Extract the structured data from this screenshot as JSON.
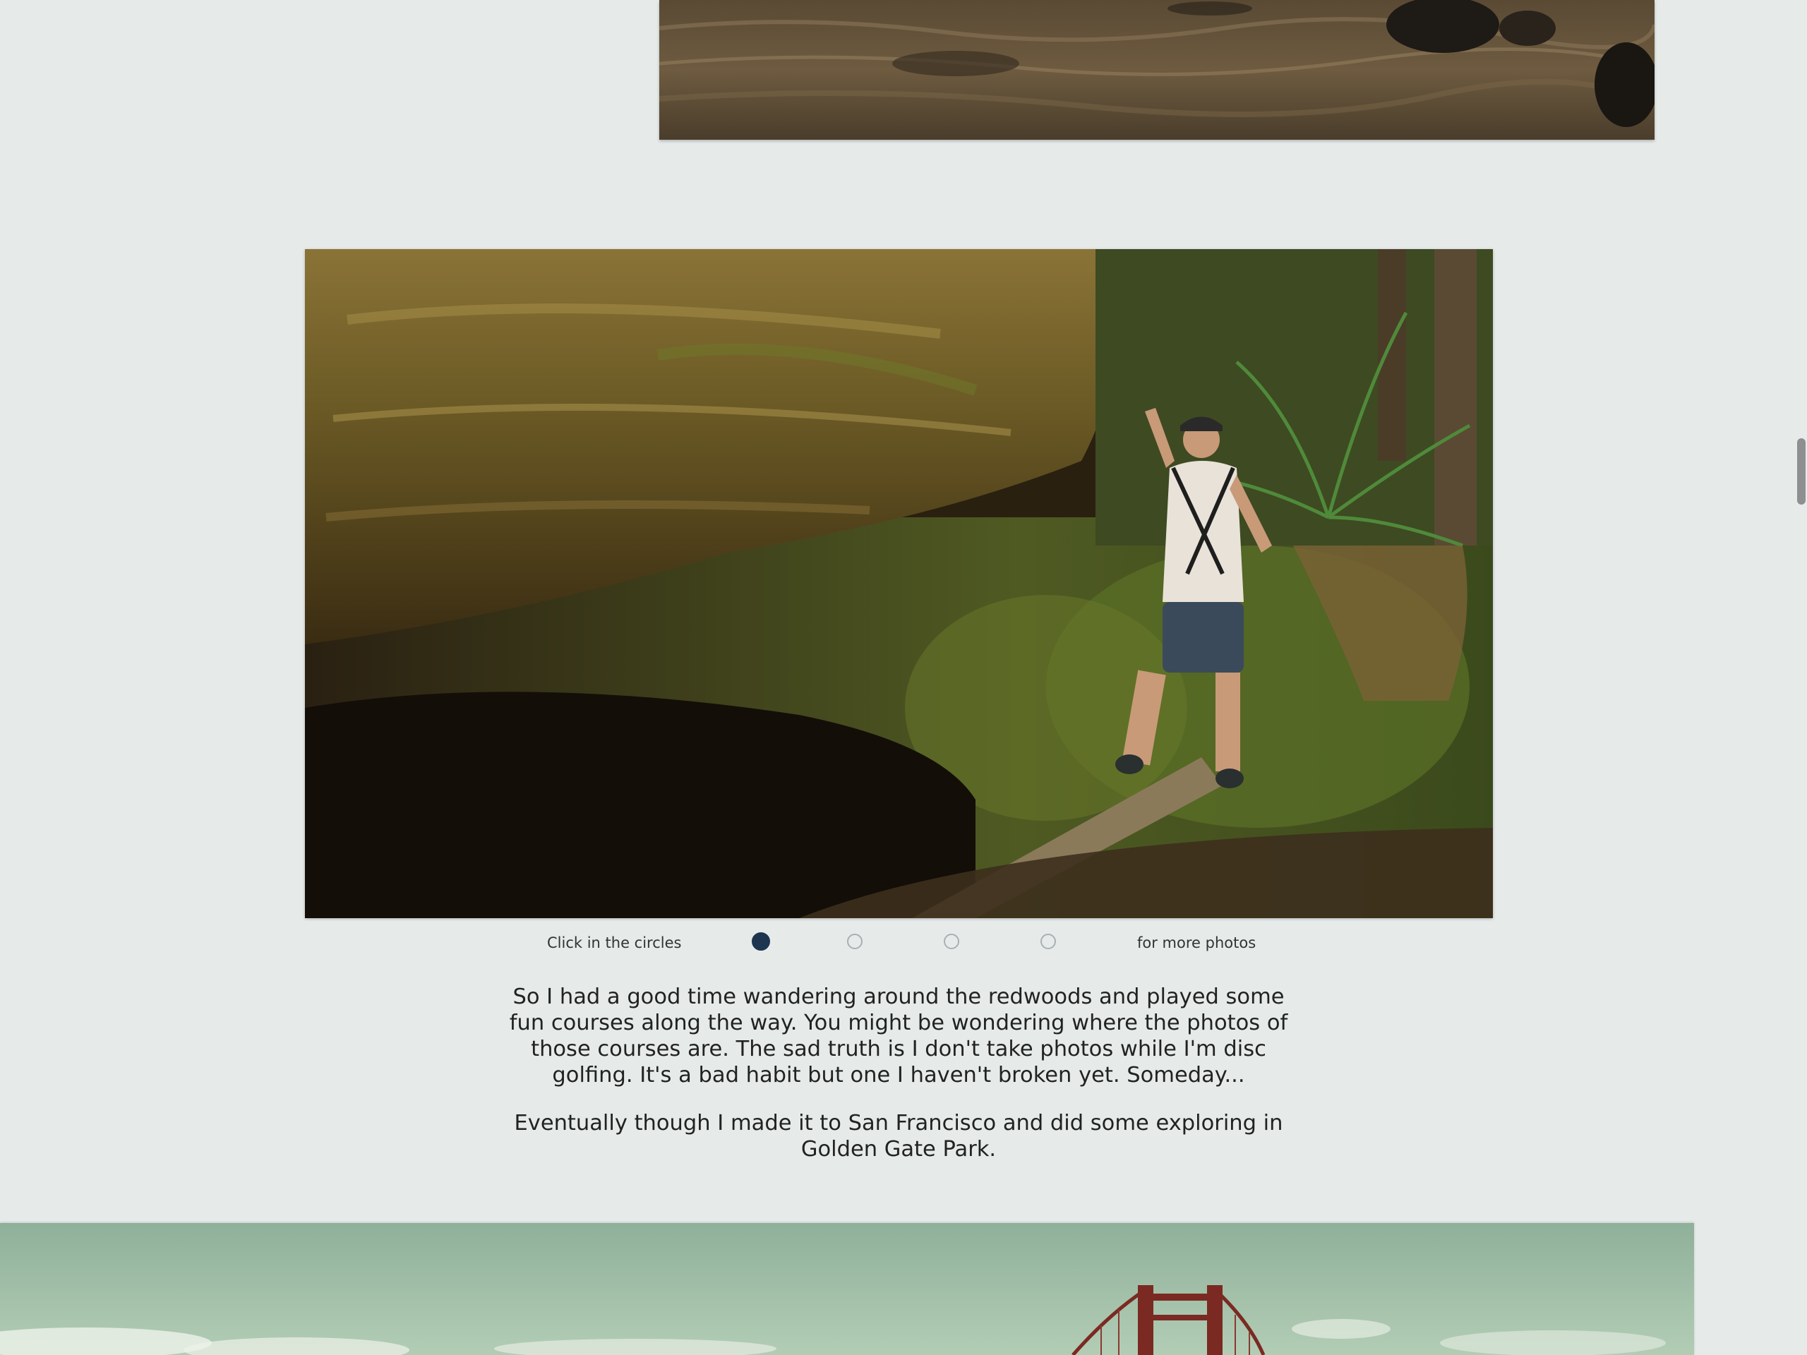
{
  "carousel": {
    "hint_left": "Click in the circles",
    "hint_right": "for more photos",
    "dots": [
      {
        "active": true
      },
      {
        "active": false
      },
      {
        "active": false
      },
      {
        "active": false
      }
    ]
  },
  "article": {
    "paragraph_1": "So I had a good time wandering around the redwoods and played some fun courses along the way. You might be wondering where the photos of those courses are. The sad truth is I don't take photos while I'm disc golfing. It's a bad habit but one I haven't broken yet. Someday...",
    "paragraph_2": "Eventually though I made it to San Francisco and did some exploring in Golden Gate Park."
  },
  "colors": {
    "background": "#e6ebea",
    "active_dot": "#1e3550",
    "inactive_dot_border": "#a9b0b2",
    "scrollbar": "#8d8f90"
  }
}
